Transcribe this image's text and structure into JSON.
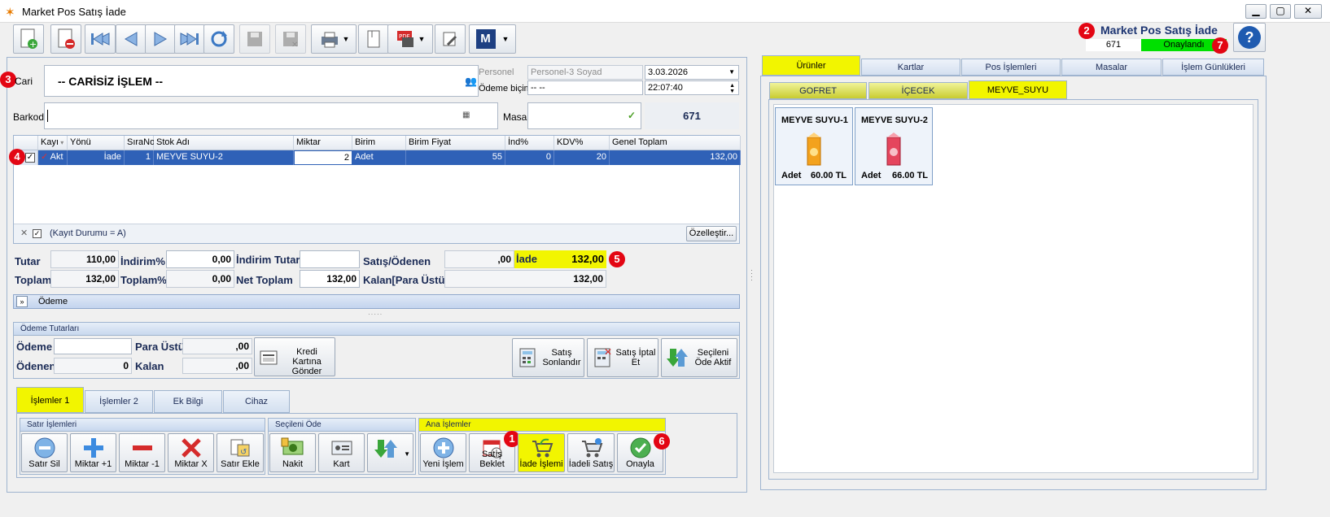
{
  "window": {
    "title": "Market Pos Satış İade"
  },
  "header": {
    "title": "Market Pos Satış İade",
    "doc_no": "671",
    "status": "Onaylandı"
  },
  "badges": [
    "1",
    "2",
    "3",
    "4",
    "5",
    "6",
    "7"
  ],
  "form": {
    "cari_label": "Cari",
    "cari_value": "-- CARİSİZ İŞLEM --",
    "personel_label": "Personel",
    "personel_value": "Personel-3 Soyad",
    "odeme_label": "Ödeme biçimi",
    "odeme_value": "-- --",
    "date": "3.03.2026",
    "time": "22:07:40",
    "barkod_label": "Barkod",
    "masa_label": "Masa",
    "masa_no": "671"
  },
  "grid": {
    "columns": [
      "Kayı",
      "Yönü",
      "SıraNo",
      "Stok Adı",
      "Miktar",
      "Birim",
      "Birim Fiyat",
      "İnd%",
      "KDV%",
      "Genel Toplam"
    ],
    "row": {
      "kayit": "Akt",
      "yonu": "İade",
      "sira": "1",
      "stok": "MEYVE SUYU-2",
      "miktar": "2",
      "birim": "Adet",
      "fiyat": "55",
      "ind": "0",
      "kdv": "20",
      "toplam": "132,00"
    },
    "filter_text": "(Kayıt Durumu = A)",
    "customize_label": "Özelleştir..."
  },
  "totals": {
    "tutar_label": "Tutar",
    "tutar": "110,00",
    "indirim_pct_label": "İndirim%",
    "indirim_pct": "0,00",
    "indirim_tutar_label": "İndirim Tutar",
    "satis_label": "Satış/Ödenen",
    "satis": ",00",
    "iade_label": "İade",
    "iade": "132,00",
    "toplam_label": "Toplam",
    "toplam": "132,00",
    "toplam_pct_label": "Toplam%",
    "toplam_pct": "0,00",
    "net_label": "Net Toplam",
    "net": "132,00",
    "kalan_label": "Kalan[Para Üstü]",
    "kalan": "132,00"
  },
  "odeme_bar": {
    "label": "Ödeme"
  },
  "payments": {
    "group_title": "Ödeme Tutarları",
    "odeme_label": "Ödeme",
    "odenen_label": "Ödenen",
    "odenen": "0",
    "para_ustu_label": "Para Üstü",
    "para_ustu": ",00",
    "kalan_label": "Kalan",
    "kalan": ",00",
    "kredi_btn": "Kredi Kartına Gönder",
    "satis_sonlandir": "Satış Sonlandır",
    "satis_iptal": "Satış İptal Et",
    "secileni_ode_aktif": "Seçileni Öde Aktif"
  },
  "bottom_tabs": [
    "İşlemler 1",
    "İşlemler 2",
    "Ek Bilgi",
    "Cihaz"
  ],
  "groups": {
    "satir": "Satır İşlemleri",
    "secileni": "Seçileni Öde",
    "ana": "Ana İşlemler"
  },
  "actions": {
    "satir_sil": "Satır Sil",
    "miktar_plus": "Miktar +1",
    "miktar_minus": "Miktar -1",
    "miktar_x": "Miktar X",
    "satir_ekle": "Satır Ekle",
    "nakit": "Nakit",
    "kart": "Kart",
    "yeni_islem": "Yeni İşlem",
    "satis_beklet": "Satış Beklet",
    "iade_islemi": "İade İşlemi",
    "iadeli_satis": "İadeli Satış",
    "onayla": "Onayla"
  },
  "right_tabs": [
    "Ürünler",
    "Kartlar",
    "Pos İşlemleri",
    "Masalar",
    "İşlem Günlükleri"
  ],
  "category_tabs": [
    "GOFRET",
    "İÇECEK",
    "MEYVE_SUYU"
  ],
  "products": [
    {
      "name": "MEYVE SUYU-1",
      "unit": "Adet",
      "price": "60.00 TL",
      "color": "#f3a21d"
    },
    {
      "name": "MEYVE SUYU-2",
      "unit": "Adet",
      "price": "66.00 TL",
      "color": "#e5455d"
    }
  ]
}
